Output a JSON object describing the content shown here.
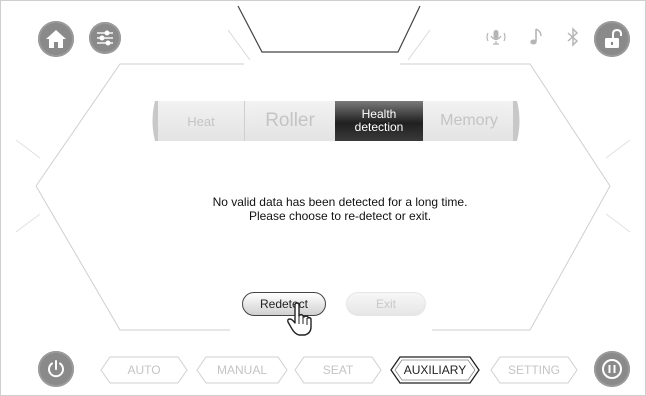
{
  "top_bar": {
    "home_icon": "home-icon",
    "settings_icon": "sliders-icon",
    "status_icons": [
      "microphone-icon",
      "music-note-icon",
      "bluetooth-icon"
    ],
    "lock_icon": "unlock-icon"
  },
  "mode_tabs": [
    {
      "label": "Heat",
      "active": false
    },
    {
      "label": "Roller",
      "active": false
    },
    {
      "label": "Health\ndetection",
      "active": true
    },
    {
      "label": "Memory",
      "active": false
    }
  ],
  "message": {
    "line1": "No valid data has been detected for a long time.",
    "line2": "Please choose to re-detect or exit."
  },
  "actions": {
    "redetect_label": "Redetect",
    "exit_label": "Exit"
  },
  "bottom_bar": {
    "power_icon": "power-icon",
    "pause_icon": "pause-icon",
    "tabs": [
      {
        "label": "AUTO",
        "active": false
      },
      {
        "label": "MANUAL",
        "active": false
      },
      {
        "label": "SEAT",
        "active": false
      },
      {
        "label": "AUXILIARY",
        "active": true
      },
      {
        "label": "SETTING",
        "active": false
      }
    ]
  },
  "colors": {
    "accent_dark": "#202020",
    "button_gray": "#8a8a8a",
    "inactive_text": "#c4c4c4"
  }
}
